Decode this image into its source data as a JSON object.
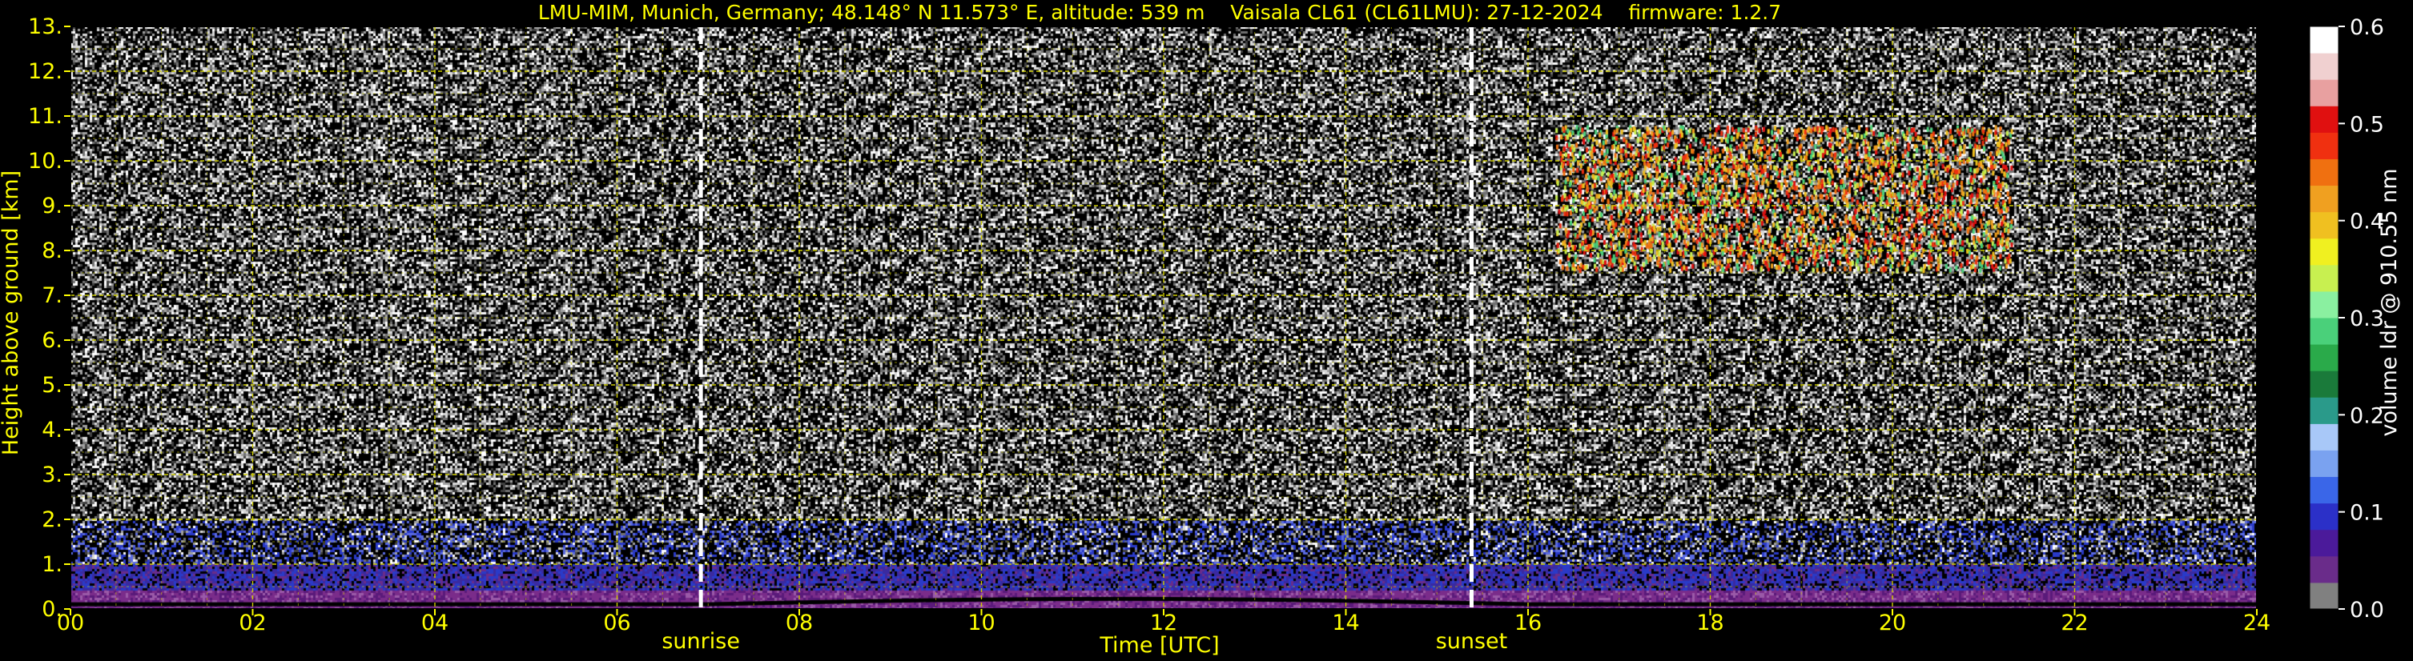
{
  "chart_data": {
    "type": "heatmap",
    "title": "LMU-MIM, Munich, Germany; 48.148° N 11.573° E, altitude: 539 m    Vaisala CL61 (CL61LMU): 27-12-2024    firmware: 1.2.7",
    "xlabel": "Time [UTC]",
    "ylabel": "Height above ground [km]",
    "colorbar_label": "volume ldr @ 910.55 nm",
    "xlim": [
      0,
      24
    ],
    "ylim": [
      0,
      13
    ],
    "x_ticks": [
      0,
      2,
      4,
      6,
      8,
      10,
      12,
      14,
      16,
      18,
      20,
      22,
      24
    ],
    "x_tick_labels": [
      "00",
      "02",
      "04",
      "06",
      "08",
      "10",
      "12",
      "14",
      "16",
      "18",
      "20",
      "22",
      "24"
    ],
    "y_ticks": [
      0,
      1,
      2,
      3,
      4,
      5,
      6,
      7,
      8,
      9,
      10,
      11,
      12,
      13
    ],
    "y_tick_labels": [
      "0.",
      "1.",
      "2.",
      "3.",
      "4.",
      "5.",
      "6.",
      "7.",
      "8.",
      "9.",
      "10.",
      "11.",
      "12.",
      "13."
    ],
    "colorbar_range": [
      0.0,
      0.6
    ],
    "colorbar_ticks": [
      0.0,
      0.1,
      0.2,
      0.3,
      0.4,
      0.5,
      0.6
    ],
    "colorbar_tick_labels": [
      "0.0",
      "0.1",
      "0.2",
      "0.3",
      "0.4",
      "0.5",
      "0.6"
    ],
    "grid": true,
    "events": [
      {
        "label": "sunrise",
        "time": 6.92
      },
      {
        "label": "sunset",
        "time": 15.38
      }
    ],
    "features": [
      {
        "kind": "cirrus",
        "time_range": [
          16.3,
          21.3
        ],
        "height_range": [
          7.6,
          10.8
        ]
      },
      {
        "kind": "boundary_layer",
        "time_range": [
          0,
          24
        ],
        "height_range": [
          0,
          2.0
        ]
      }
    ],
    "colors": {
      "background": "#000000",
      "text": "#ffff00",
      "grid": "#cccc00",
      "event_line": "#ffffff",
      "colormap": [
        "#808080",
        "#6a2c8a",
        "#4b1a9a",
        "#2b30c8",
        "#3a66e8",
        "#7aa2f0",
        "#a8c8f8",
        "#2a9a8a",
        "#1a7a3a",
        "#2aaa4a",
        "#4ad07a",
        "#8af0a0",
        "#c8f050",
        "#f0f020",
        "#f0c020",
        "#f0a020",
        "#f07010",
        "#f03010",
        "#e01010",
        "#e8a0a0",
        "#f0d0d0",
        "#ffffff"
      ]
    }
  }
}
